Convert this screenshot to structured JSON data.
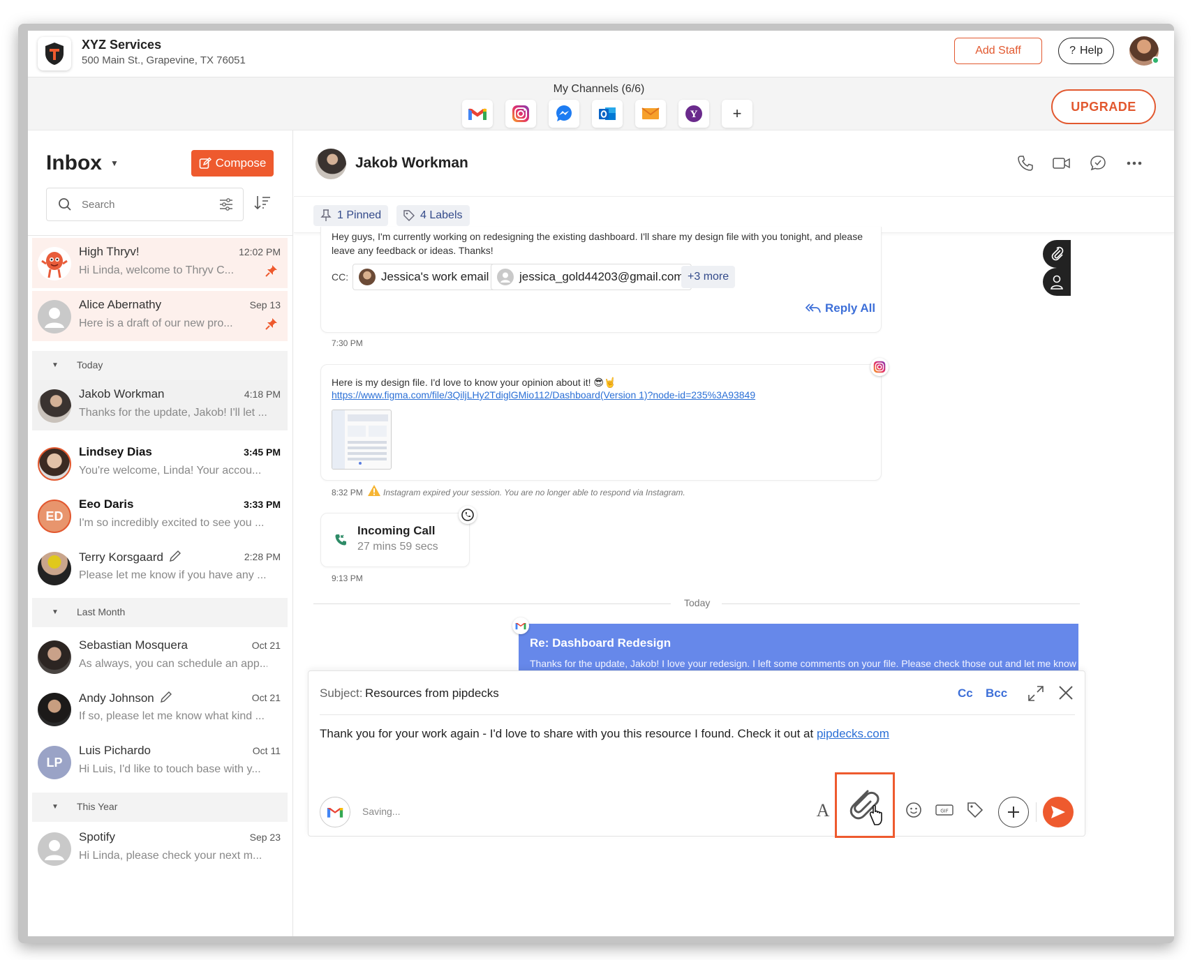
{
  "business": {
    "name": "XYZ Services",
    "address": "500 Main St., Grapevine, TX 76051"
  },
  "header": {
    "add_staff": "Add Staff",
    "help": "Help"
  },
  "channels": {
    "title": "My Channels (6/6)",
    "items": [
      "gmail-icon",
      "instagram-icon",
      "messenger-icon",
      "outlook-icon",
      "email-icon",
      "yahoo-icon"
    ],
    "add": "+",
    "upgrade": "UPGRADE"
  },
  "sidebar": {
    "title": "Inbox",
    "compose": "Compose",
    "search_placeholder": "Search",
    "conversations": [
      {
        "name": "High Thryv!",
        "time": "12:02 PM",
        "preview": "Hi Linda, welcome to Thryv C...",
        "pinned": true
      },
      {
        "name": "Alice Abernathy",
        "time": "Sep 13",
        "preview": "Here is a draft of our new pro...",
        "pinned": true
      }
    ],
    "sections": {
      "today": "Today",
      "last_month": "Last Month",
      "this_year": "This Year"
    },
    "today": [
      {
        "name": "Jakob Workman",
        "time": "4:18 PM",
        "preview": "Thanks for the update, Jakob! I'll let ..."
      },
      {
        "name": "Lindsey Dias",
        "time": "3:45 PM",
        "preview": "You're welcome, Linda! Your accou..."
      },
      {
        "name": "Eeo Daris",
        "initials": "ED",
        "time": "3:33 PM",
        "preview": "I'm so incredibly excited to see you ..."
      },
      {
        "name": "Terry Korsgaard",
        "time": "2:28 PM",
        "preview": "Please let me know if you have any ..."
      }
    ],
    "last_month": [
      {
        "name": "Sebastian Mosquera",
        "time": "Oct 21",
        "preview": "As always, you can schedule an app..."
      },
      {
        "name": "Andy Johnson",
        "time": "Oct 21",
        "preview": "If so, please let me know what kind ..."
      },
      {
        "name": "Luis Pichardo",
        "initials": "LP",
        "time": "Oct 11",
        "preview": "Hi Luis, I'd like to touch base with y..."
      }
    ],
    "this_year": [
      {
        "name": "Spotify",
        "time": "Sep 23",
        "preview": "Hi Linda, please check your next m..."
      }
    ]
  },
  "chat": {
    "contact": "Jakob Workman",
    "pinned": "1 Pinned",
    "labels": "4 Labels",
    "email_msg": {
      "text1": "Hey guys, I'm currently working on redesigning the existing dashboard. I'll share my design file with you tonight, and please",
      "text2": "leave any feedback or ideas. Thanks!",
      "cc_label": "CC:",
      "cc1": "Jessica's work email",
      "cc2": "jessica_gold44203@gmail.com",
      "cc_more": "+3 more",
      "reply_all": "Reply All",
      "time": "7:30 PM"
    },
    "ig_msg": {
      "text": "Here is my design file. I'd love to know your opinion about it! 😎🤘",
      "link": "https://www.figma.com/file/3QiljLHy2TdiglGMio112/Dashboard(Version 1)?node-id=235%3A93849",
      "time": "8:32 PM",
      "warning": "Instagram expired your session. You are no longer able to respond via Instagram."
    },
    "call": {
      "title": "Incoming Call",
      "duration": "27 mins 59 secs",
      "time": "9:13 PM"
    },
    "divider": "Today",
    "sent": {
      "title": "Re: Dashboard Redesign",
      "body": "Thanks for the update, Jakob! I love your redesign. I left some comments on your file. Please check those out and let me know if"
    }
  },
  "composer": {
    "subject_label": "Subject:",
    "subject": "Resources from pipdecks",
    "cc": "Cc",
    "bcc": "Bcc",
    "body": "Thank you for your work again - I'd love to share with you this resource I found. Check it out at ",
    "link": "pipdecks.com",
    "status": "Saving..."
  },
  "colors": {
    "accent": "#ee5a2e",
    "link": "#3d6fd8",
    "sent_bubble": "#6688ea"
  }
}
